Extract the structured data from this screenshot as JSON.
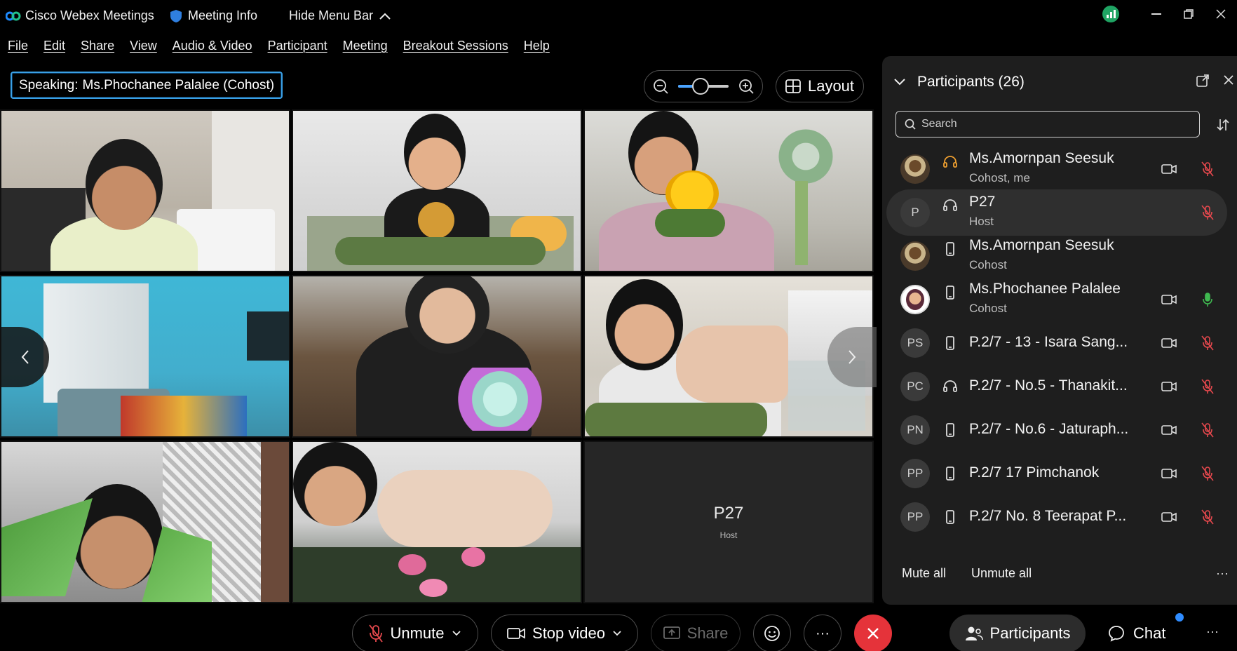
{
  "titlebar": {
    "app_name": "Cisco Webex Meetings",
    "meeting_info": "Meeting Info",
    "hide_menu": "Hide Menu Bar",
    "accent": "#1fa463"
  },
  "menu": [
    "File",
    "Edit",
    "Share",
    "View",
    "Audio & Video",
    "Participant",
    "Meeting",
    "Breakout Sessions",
    "Help"
  ],
  "speaking": {
    "label": "Speaking:",
    "name": "Ms.Phochanee Palalee (Cohost)"
  },
  "zoom": {
    "level": 0.45
  },
  "layout_label": "Layout",
  "video_tiles": [
    {
      "kind": "video",
      "scene": "boy smiling at desk"
    },
    {
      "kind": "video",
      "scene": "boy with leaves at table"
    },
    {
      "kind": "video",
      "scene": "boy holding flower krathong"
    },
    {
      "kind": "video",
      "scene": "empty blue room"
    },
    {
      "kind": "video",
      "scene": "boy with pink lotus"
    },
    {
      "kind": "video",
      "scene": "boy folding leaves"
    },
    {
      "kind": "video",
      "scene": "boy with glasses holding leaf"
    },
    {
      "kind": "video",
      "scene": "hands arranging flowers"
    },
    {
      "kind": "name",
      "name": "P27",
      "role": "Host"
    }
  ],
  "participants_panel": {
    "title": "Participants (26)",
    "search_placeholder": "Search",
    "rows": [
      {
        "initials": "",
        "avatar": "photo",
        "device": "headset-orange",
        "name": "Ms.Amornpan Seesuk",
        "role": "Cohost, me",
        "cam": true,
        "mic": "muted"
      },
      {
        "initials": "P",
        "avatar": "initials",
        "device": "headset",
        "name": "P27",
        "role": "Host",
        "cam": false,
        "mic": "muted",
        "selected": true
      },
      {
        "initials": "",
        "avatar": "photo",
        "device": "phone",
        "name": "Ms.Amornpan Seesuk",
        "role": "Cohost",
        "cam": false,
        "mic": "none"
      },
      {
        "initials": "",
        "avatar": "photo2",
        "device": "phone",
        "name": "Ms.Phochanee Palalee",
        "role": "Cohost",
        "cam": true,
        "mic": "active"
      },
      {
        "initials": "PS",
        "avatar": "initials",
        "device": "phone",
        "name": "P.2/7 - 13 - Isara Sang...",
        "role": "",
        "cam": true,
        "mic": "muted"
      },
      {
        "initials": "PC",
        "avatar": "initials",
        "device": "headset",
        "name": "P.2/7 - No.5 - Thanakit...",
        "role": "",
        "cam": true,
        "mic": "muted"
      },
      {
        "initials": "PN",
        "avatar": "initials",
        "device": "phone",
        "name": "P.2/7 - No.6 - Jaturaph...",
        "role": "",
        "cam": true,
        "mic": "muted"
      },
      {
        "initials": "PP",
        "avatar": "initials",
        "device": "phone",
        "name": "P.2/7 17 Pimchanok",
        "role": "",
        "cam": true,
        "mic": "muted"
      },
      {
        "initials": "PP",
        "avatar": "initials",
        "device": "phone",
        "name": "P.2/7 No. 8 Teerapat P...",
        "role": "",
        "cam": true,
        "mic": "muted"
      }
    ],
    "mute_all": "Mute all",
    "unmute_all": "Unmute all"
  },
  "controls": {
    "unmute": "Unmute",
    "stop_video": "Stop video",
    "share": "Share",
    "participants": "Participants",
    "chat": "Chat",
    "end_color": "#e5333a",
    "muted_color": "#e5484d",
    "active_mic_color": "#3fb950"
  }
}
